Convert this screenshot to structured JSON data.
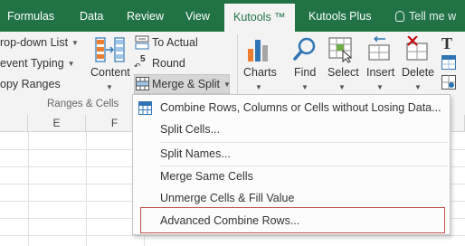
{
  "tabs": {
    "formulas": "Formulas",
    "data": "Data",
    "review": "Review",
    "view": "View",
    "kutools": "Kutools ™",
    "kutools_plus": "Kutools Plus",
    "tell_me": "Tell me w"
  },
  "ribbon": {
    "left_items": [
      "rop-down List",
      "event Typing",
      "opy Ranges"
    ],
    "content_label": "Content",
    "to_actual_label": "To Actual",
    "round_label": "Round",
    "round_icon_text": "5",
    "merge_split_label": "Merge & Split",
    "group_label": "Ranges & Cells",
    "charts_label": "Charts",
    "find_label": "Find",
    "select_label": "Select",
    "insert_label": "Insert",
    "delete_label": "Delete",
    "text_icon_letter": "T"
  },
  "grid": {
    "columns": [
      "E",
      "F"
    ]
  },
  "menu": {
    "items": [
      "Combine Rows, Columns or Cells without Losing Data...",
      "Split Cells...",
      "Split Names...",
      "Merge Same Cells",
      "Unmerge Cells & Fill Value",
      "Advanced Combine Rows..."
    ]
  },
  "colors": {
    "tab_bar": "#217346",
    "ribbon_bg": "#f3f3f3",
    "highlight_box": "#c0504d",
    "icon_blue": "#2f75b5",
    "icon_orange": "#ed7d31"
  }
}
